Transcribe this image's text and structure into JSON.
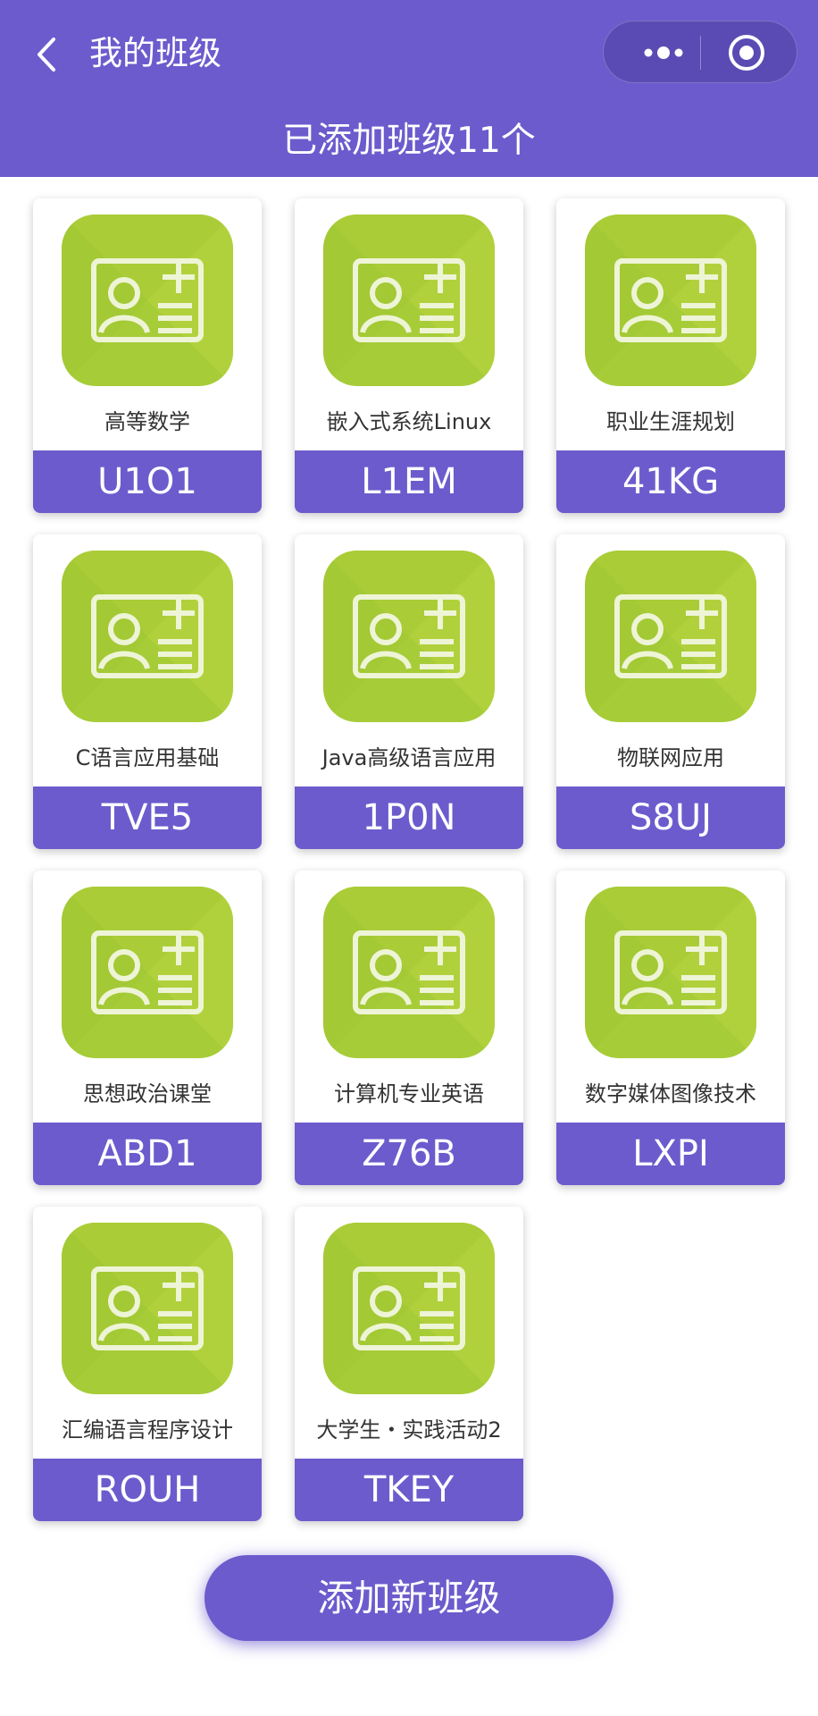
{
  "header": {
    "title": "我的班级",
    "back_icon": "chevron-left-icon",
    "more_icon": "ellipsis-icon",
    "record_icon": "target-circle-icon",
    "background_color": "#6c5bcd"
  },
  "summary": {
    "text": "已添加班级11个"
  },
  "classes": [
    {
      "name": "高等数学",
      "code": "U1O1"
    },
    {
      "name": "嵌入式系统Linux",
      "code": "L1EM"
    },
    {
      "name": "职业生涯规划",
      "code": "41KG"
    },
    {
      "name": "C语言应用基础",
      "code": "TVE5"
    },
    {
      "name": "Java高级语言应用",
      "code": "1P0N"
    },
    {
      "name": "物联网应用",
      "code": "S8UJ"
    },
    {
      "name": "思想政治课堂",
      "code": "ABD1"
    },
    {
      "name": "计算机专业英语",
      "code": "Z76B"
    },
    {
      "name": "数字媒体图像技术",
      "code": "LXPI"
    },
    {
      "name": "汇编语言程序设计",
      "code": "ROUH"
    },
    {
      "name": "大学生・实践活动2",
      "code": "TKEY"
    }
  ],
  "class_icon": "id-card-add-icon",
  "tile_color": "#a6cc38",
  "accent_color": "#6c5bcd",
  "add_button": {
    "label": "添加新班级"
  }
}
